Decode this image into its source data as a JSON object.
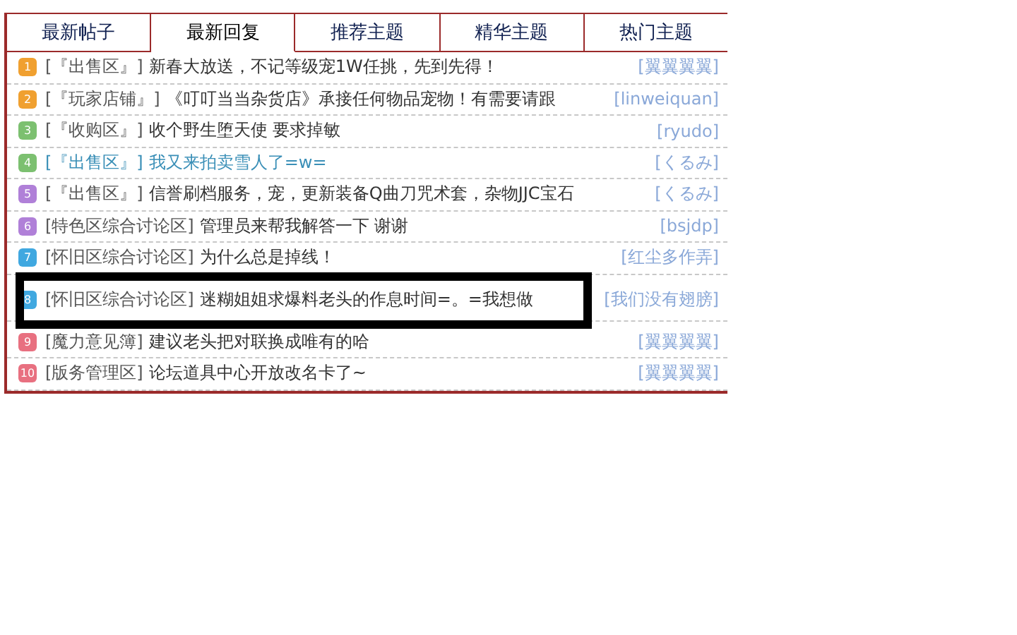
{
  "tabs": [
    {
      "label": "最新帖子",
      "selected": false
    },
    {
      "label": "最新回复",
      "selected": true
    },
    {
      "label": "推荐主题",
      "selected": false
    },
    {
      "label": "精华主题",
      "selected": false
    },
    {
      "label": "热门主题",
      "selected": false
    }
  ],
  "posts": [
    {
      "rank": "1",
      "color": "#f0a030",
      "category": "[『出售区』]",
      "title": "新春大放送，不记等级宠1W任挑，先到先得！",
      "author": "[翼翼翼翼]",
      "highlighted": false,
      "framed": false
    },
    {
      "rank": "2",
      "color": "#f0a030",
      "category": "[『玩家店铺』]",
      "title": "《叮叮当当杂货店》承接任何物品宠物！有需要请跟",
      "author": "[linweiquan]",
      "highlighted": false,
      "framed": false
    },
    {
      "rank": "3",
      "color": "#7cc070",
      "category": "[『收购区』]",
      "title": "收个野生堕天使 要求掉敏",
      "author": "[ryudo]",
      "highlighted": false,
      "framed": false
    },
    {
      "rank": "4",
      "color": "#7cc070",
      "category": "[『出售区』]",
      "title": "我又来拍卖雪人了=w=",
      "author": "[くるみ]",
      "highlighted": true,
      "framed": false
    },
    {
      "rank": "5",
      "color": "#b080d8",
      "category": "[『出售区』]",
      "title": "信誉刷档服务，宠，更新装备Q曲刀咒术套，杂物JJC宝石",
      "author": "[くるみ]",
      "highlighted": false,
      "framed": false
    },
    {
      "rank": "6",
      "color": "#b080d8",
      "category": "[特色区综合讨论区]",
      "title": "管理员来帮我解答一下 谢谢",
      "author": "[bsjdp]",
      "highlighted": false,
      "framed": false
    },
    {
      "rank": "7",
      "color": "#40a8e0",
      "category": "[怀旧区综合讨论区]",
      "title": "为什么总是掉线！",
      "author": "[红尘多作弄]",
      "highlighted": false,
      "framed": false
    },
    {
      "rank": "8",
      "color": "#40a8e0",
      "category": "[怀旧区综合讨论区]",
      "title": "迷糊姐姐求爆料老头的作息时间=。=我想做",
      "author": "[我们没有翅膀]",
      "highlighted": false,
      "framed": true
    },
    {
      "rank": "9",
      "color": "#e87080",
      "category": "[魔力意见簿]",
      "title": "建议老头把对联换成唯有的哈",
      "author": "[翼翼翼翼]",
      "highlighted": false,
      "framed": false
    },
    {
      "rank": "10",
      "color": "#e87080",
      "category": "[版务管理区]",
      "title": "论坛道具中心开放改名卡了~",
      "author": "[翼翼翼翼]",
      "highlighted": false,
      "framed": false
    }
  ]
}
